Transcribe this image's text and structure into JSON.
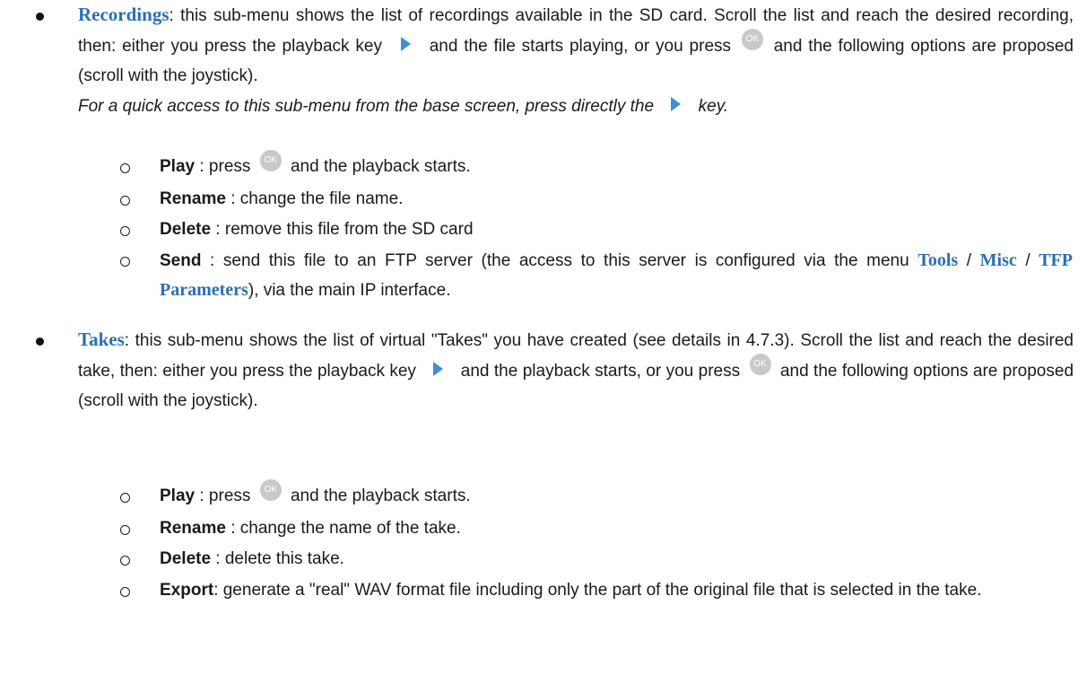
{
  "icons": {
    "play": "play-key-icon",
    "ok": "ok-button-icon",
    "ok_label": "OK"
  },
  "recordings": {
    "term": "Recordings",
    "text_1": ": this sub-menu shows the list of recordings available in the SD card. Scroll the list and reach the desired recording, then: either you press the playback key",
    "text_2": "and the file starts playing, or you press",
    "text_3": "and the following options are proposed (scroll with the joystick).",
    "note_1": "For a quick access to this sub-menu from the base screen, press directly the",
    "note_2": "key.",
    "options": {
      "play_label": "Play",
      "play_text_1": " : press",
      "play_text_2": "and the playback starts.",
      "rename_label": "Rename",
      "rename_text": " : change the file name.",
      "delete_label": "Delete",
      "delete_text": " : remove this file from the SD card",
      "send_label": "Send",
      "send_text_1": " : send this file to an FTP server (the access to this server is configured via the menu",
      "send_menu_1": "Tools",
      "send_sep_1": " / ",
      "send_menu_2": "Misc",
      "send_sep_2": " / ",
      "send_menu_3": "TFP Parameters",
      "send_text_2": "), via the main IP interface."
    }
  },
  "takes": {
    "term": "Takes",
    "text_1": ": this sub-menu shows the list of virtual \"Takes\" you have created (see details in 4.7.3). Scroll the list and reach the desired take, then: either you press the playback key",
    "text_2": "and the playback starts, or you press",
    "text_3": "and the following options are proposed (scroll with the joystick).",
    "options": {
      "play_label": "Play",
      "play_text_1": " : press",
      "play_text_2": "and the playback starts.",
      "rename_label": "Rename",
      "rename_text": " : change the name of the take.",
      "delete_label": "Delete",
      "delete_text": " : delete this take.",
      "export_label": "Export",
      "export_text": ": generate a \"real\" WAV format file including only the part of the original file that is selected in the take."
    }
  }
}
